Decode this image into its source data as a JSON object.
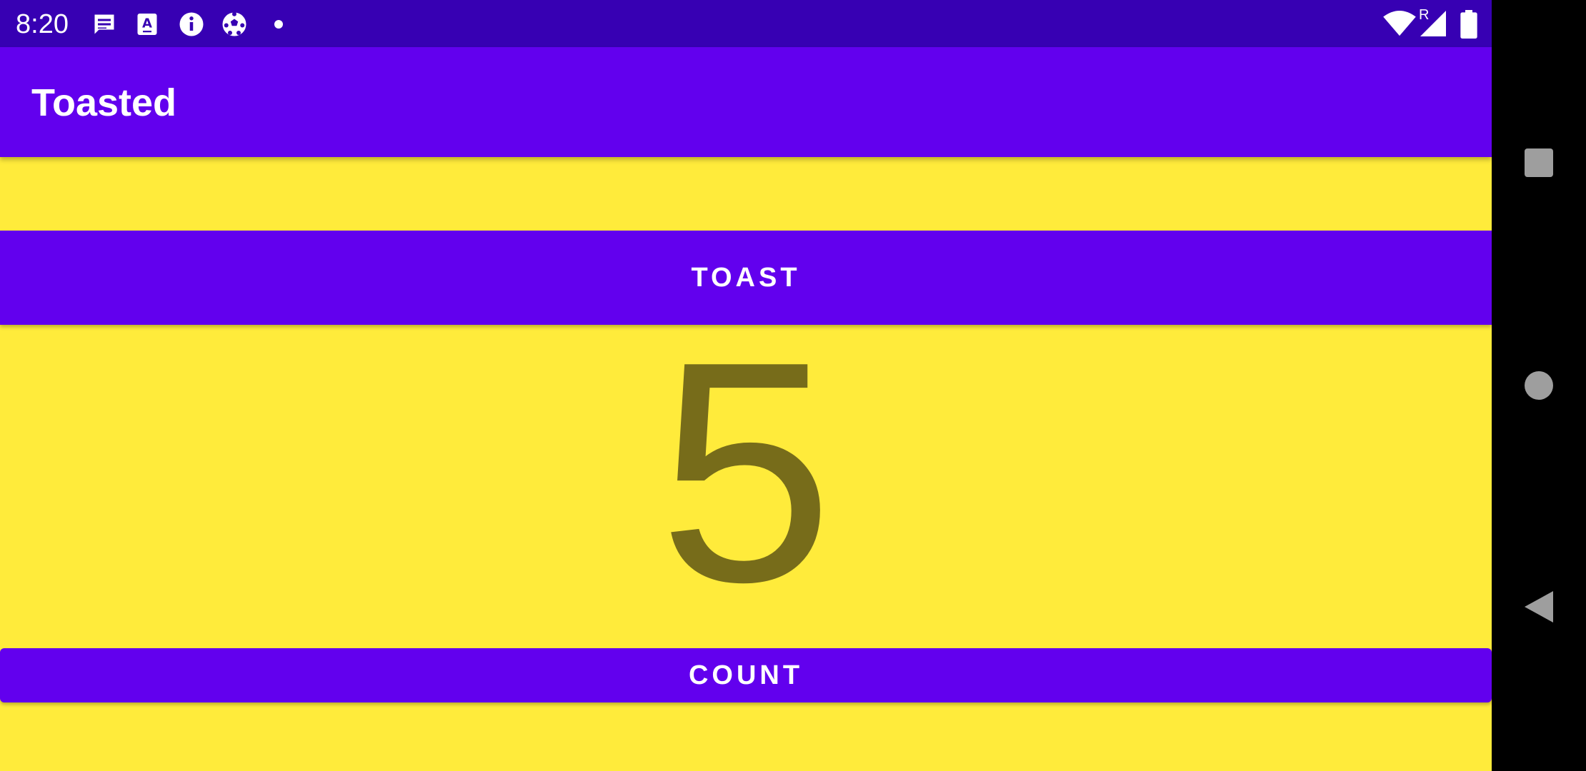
{
  "status_bar": {
    "time": "8:20",
    "notification_icons": [
      "message-icon",
      "text-a-icon",
      "info-icon",
      "soccer-ball-icon",
      "dot-icon"
    ],
    "system_icons": [
      "wifi-icon",
      "cell-signal-icon",
      "battery-icon"
    ],
    "roaming_label": "R",
    "background": "#3700B3"
  },
  "app_bar": {
    "title": "Toasted",
    "background": "#6200EE"
  },
  "main": {
    "background": "#FFEB3B",
    "toast_button_label": "TOAST",
    "count_value": "5",
    "count_color": "#776C1A",
    "count_button_label": "COUNT"
  },
  "nav_bar": {
    "buttons": [
      "recents-square-icon",
      "home-circle-icon",
      "back-triangle-icon"
    ]
  }
}
